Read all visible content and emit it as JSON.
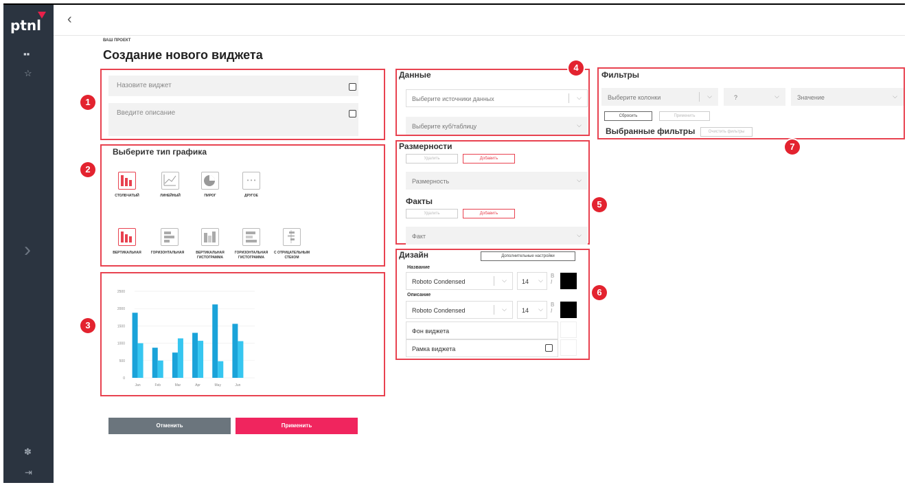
{
  "app": {
    "logo": "ptnl"
  },
  "header": {
    "breadcrumb": "ВАШ ПРОЕКТ",
    "title": "Создание нового виджета"
  },
  "badges": [
    "1",
    "2",
    "3",
    "4",
    "5",
    "6",
    "7"
  ],
  "section1": {
    "name_placeholder": "Назовите виджет",
    "desc_placeholder": "Введите описание"
  },
  "section2": {
    "title": "Выберите тип графика",
    "types": [
      {
        "label": "СТОЛБЧАТЫЙ",
        "icon": "bar-chart-icon",
        "active": true
      },
      {
        "label": "ЛИНЕЙНЫЙ",
        "icon": "line-chart-icon",
        "active": false
      },
      {
        "label": "ПИРОГ",
        "icon": "pie-chart-icon",
        "active": false
      },
      {
        "label": "ДРУГОЕ",
        "icon": "more-icon",
        "active": false
      }
    ],
    "subtypes": [
      {
        "label": "ВЕРТИКАЛЬНАЯ",
        "icon": "vertical-bar-icon",
        "active": true
      },
      {
        "label": "ГОРИЗОНТАЛЬНАЯ",
        "icon": "horizontal-bar-icon",
        "active": false
      },
      {
        "label": "ВЕРТИКАЛЬНАЯ ГИСТОГРАММА",
        "icon": "vertical-histogram-icon",
        "active": false
      },
      {
        "label": "ГОРИЗОНТАЛЬНАЯ ГИСТОГРАММА",
        "icon": "horizontal-histogram-icon",
        "active": false
      },
      {
        "label": "С ОТРИЦАТЕЛЬНЫМ СТЕКОМ",
        "icon": "negative-stack-icon",
        "active": false
      }
    ]
  },
  "chart_data": {
    "type": "bar",
    "categories": [
      "Jan",
      "Feb",
      "Mar",
      "Apr",
      "May",
      "Jun"
    ],
    "series": [
      {
        "values": [
          1880,
          870,
          730,
          1300,
          2120,
          1560
        ],
        "color": "#1aa3d9"
      },
      {
        "values": [
          1000,
          500,
          1140,
          1070,
          480,
          1060
        ],
        "color": "#36c6f0"
      }
    ],
    "yticks": [
      "0",
      "500",
      "1000",
      "1500",
      "2000",
      "2500"
    ],
    "ylim": [
      0,
      2500
    ],
    "grid": true
  },
  "section4": {
    "title": "Данные",
    "source_placeholder": "Выберите источники данных",
    "cube_placeholder": "Выберите куб/таблицу"
  },
  "section5": {
    "dims_title": "Размерности",
    "delete_label": "Удалить",
    "add_label": "Добавить",
    "dim_placeholder": "Размерность",
    "facts_title": "Факты",
    "fact_placeholder": "Факт"
  },
  "section6": {
    "title": "Дизайн",
    "extra_settings": "Дополнительные настройки",
    "name_label": "Название",
    "desc_label": "Описание",
    "font": "Roboto Condensed",
    "size": "14",
    "bold_glyph": "B",
    "italic_glyph": "I",
    "bg_label": "Фон виджета",
    "border_label": "Рамка виджета",
    "text_color": "#000000"
  },
  "section7": {
    "title": "Фильтры",
    "column_placeholder": "Выберите колонки",
    "op_placeholder": "?",
    "value_placeholder": "Значение",
    "reset_label": "Сбросить",
    "apply_label": "Применить",
    "selected_title": "Выбранные фильтры",
    "clear_label": "Очистить фильтры"
  },
  "footer": {
    "cancel_label": "Отменить",
    "apply_label": "Применить",
    "cancel_color": "#6b757d",
    "apply_color": "#f0255e"
  }
}
